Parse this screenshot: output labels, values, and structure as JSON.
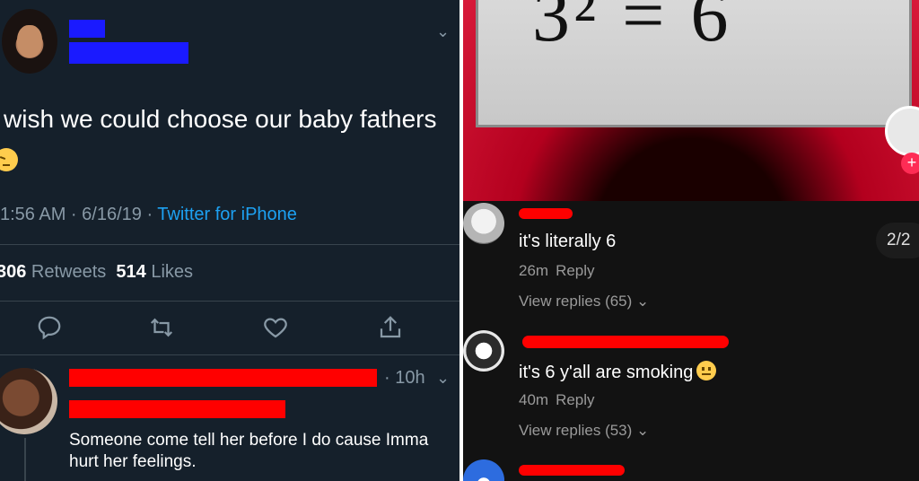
{
  "left_panel": {
    "tweet": {
      "text": "wish we could choose our baby fathers",
      "meta_time": "1:56 AM · 6/16/19 · ",
      "meta_source": "Twitter for iPhone",
      "retweets_count": "306",
      "retweets_label": " Retweets  ",
      "likes_count": "514",
      "likes_label": " Likes"
    },
    "reply": {
      "time": "· 10h",
      "text": "Someone come tell her before I do cause Imma hurt her feelings."
    },
    "colors": {
      "background": "#15202b",
      "accent": "#1da1f2",
      "muted": "#8899a6",
      "redaction_blue": "#1a1aff",
      "redaction_red": "#ff0000"
    },
    "icons": [
      "chevron-down-icon",
      "reply-icon",
      "retweet-icon",
      "like-icon",
      "share-icon",
      "pensive-emoji-icon"
    ]
  },
  "right_panel": {
    "video_equation": "3² = 6",
    "counter": "2/2",
    "comments": [
      {
        "text": "it's literally 6",
        "age": "26m",
        "reply_label": "Reply",
        "view_replies": "View replies (65)"
      },
      {
        "text": "it's 6 y'all are smoking",
        "age": "40m",
        "reply_label": "Reply",
        "view_replies": "View replies (53)"
      }
    ],
    "colors": {
      "background": "#121212",
      "video_red": "#d81a3a",
      "follow_button": "#fe2c55",
      "redaction": "#ff0000"
    },
    "icons": [
      "follow-plus-icon",
      "chevron-down-icon",
      "neutral-face-emoji-icon"
    ]
  }
}
